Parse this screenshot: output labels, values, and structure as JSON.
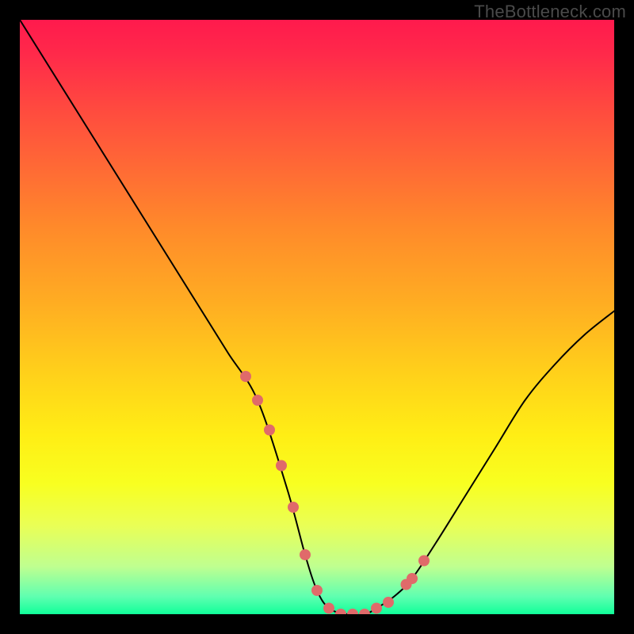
{
  "watermark": "TheBottleneck.com",
  "chart_data": {
    "type": "line",
    "title": "",
    "xlabel": "",
    "ylabel": "",
    "xlim": [
      0,
      100
    ],
    "ylim": [
      0,
      100
    ],
    "grid": false,
    "legend": false,
    "series": [
      {
        "name": "bottleneck-curve",
        "x": [
          0,
          5,
          10,
          15,
          20,
          25,
          30,
          35,
          40,
          45,
          48,
          50,
          52,
          55,
          58,
          60,
          63,
          66,
          70,
          75,
          80,
          85,
          90,
          95,
          100
        ],
        "y": [
          100,
          92,
          84,
          76,
          68,
          60,
          52,
          44,
          36,
          21,
          10,
          4,
          1,
          0,
          0,
          1,
          3,
          6,
          12,
          20,
          28,
          36,
          42,
          47,
          51
        ],
        "color": "#000000",
        "width": 2
      }
    ],
    "data_markers": {
      "name": "highlighted-range",
      "color": "#e06a6a",
      "radius": 7,
      "points_x": [
        38,
        40,
        42,
        44,
        46,
        48,
        50,
        52,
        54,
        56,
        58,
        60,
        62,
        65,
        66,
        68
      ],
      "points_y": [
        40,
        36,
        31,
        25,
        18,
        10,
        4,
        1,
        0,
        0,
        0,
        1,
        2,
        5,
        6,
        9
      ]
    }
  }
}
